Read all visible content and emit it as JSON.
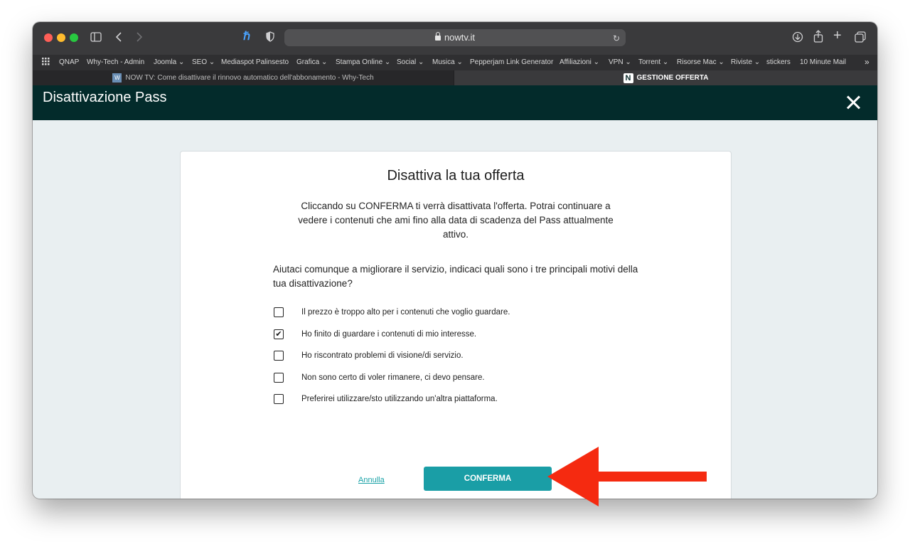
{
  "browser": {
    "url": "nowtv.it",
    "bookmarks": [
      "QNAP",
      "Why-Tech - Admin",
      "Joomla ⌄",
      "SEO ⌄",
      "Mediaspot Palinsesto",
      "Grafica ⌄",
      "Stampa Online ⌄",
      "Social ⌄",
      "Musica ⌄",
      "Pepperjam Link Generator",
      "Affiliazioni ⌄",
      "VPN ⌄",
      "Torrent ⌄",
      "Risorse Mac ⌄",
      "Riviste ⌄",
      "stickers",
      "10 Minute Mail"
    ],
    "tabs": [
      {
        "label": "NOW TV: Come disattivare il rinnovo automatico dell'abbonamento - Why-Tech",
        "favicon": "W"
      },
      {
        "label": "GESTIONE OFFERTA",
        "favicon": "N"
      }
    ]
  },
  "page": {
    "header_title": "Disattivazione Pass"
  },
  "card": {
    "title": "Disattiva la tua offerta",
    "description": "Cliccando su CONFERMA ti verrà disattivata l'offerta. Potrai continuare a vedere i contenuti che ami fino alla data di scadenza del Pass attualmente attivo.",
    "question": "Aiutaci comunque a migliorare il servizio, indicaci quali sono i tre principali motivi della tua disattivazione?",
    "options": [
      {
        "label": "Il prezzo è troppo alto per i contenuti che voglio guardare.",
        "checked": false
      },
      {
        "label": "Ho finito di guardare i contenuti di mio interesse.",
        "checked": true
      },
      {
        "label": "Ho riscontrato problemi di visione/di servizio.",
        "checked": false
      },
      {
        "label": "Non sono certo di voler rimanere, ci devo pensare.",
        "checked": false
      },
      {
        "label": "Preferirei utilizzare/sto utilizzando un'altra piattaforma.",
        "checked": false
      }
    ],
    "cancel_label": "Annulla",
    "confirm_label": "CONFERMA"
  },
  "colors": {
    "header_bg": "#032b2b",
    "confirm_bg": "#1a9ea6",
    "annotation_arrow": "#f52a10"
  }
}
